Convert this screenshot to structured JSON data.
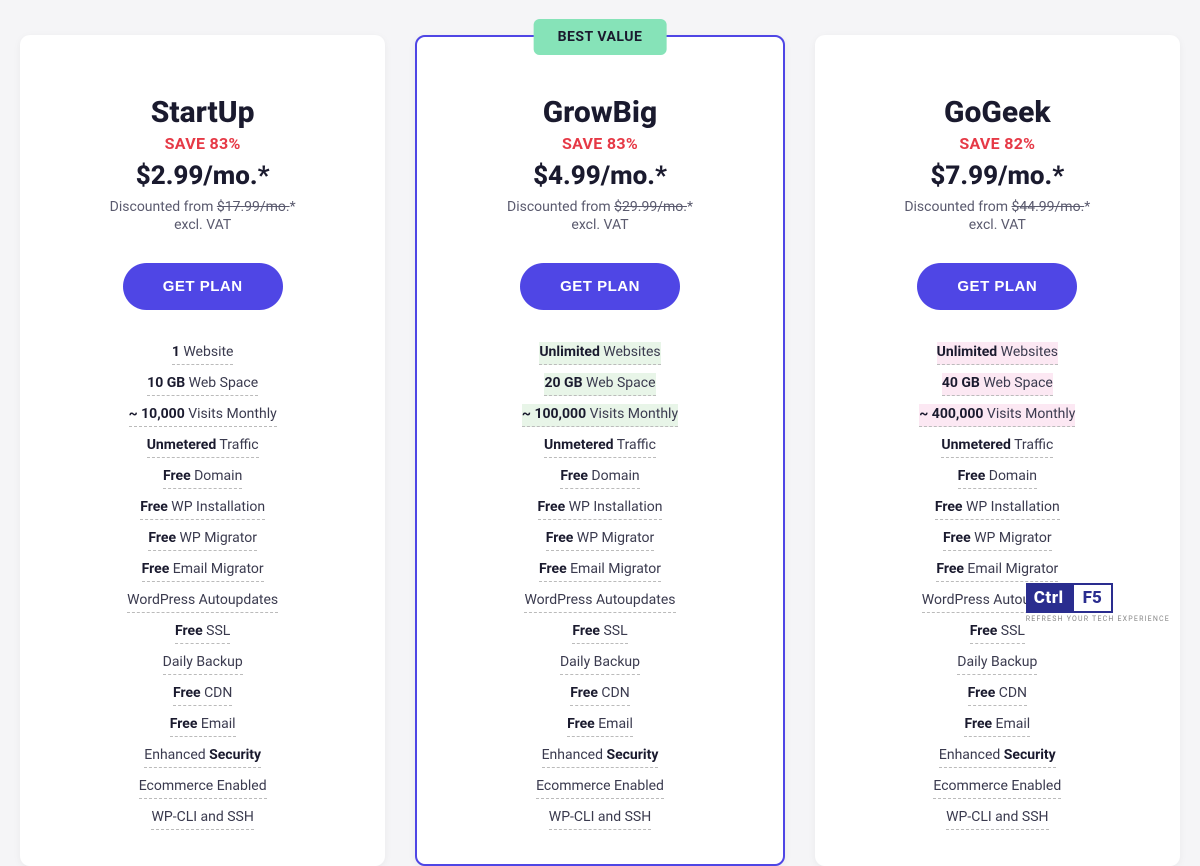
{
  "plans": [
    {
      "name": "StartUp",
      "save": "SAVE 83%",
      "price": "$2.99/mo.*",
      "discount_prefix": "Discounted from ",
      "discount_strike": "$17.99/mo.",
      "discount_suffix": "*",
      "vat": "excl. VAT",
      "cta": "GET PLAN",
      "featured": false,
      "badge": null,
      "features": [
        {
          "bold": "1",
          "rest": " Website",
          "highlight": null
        },
        {
          "bold": "10 GB",
          "rest": " Web Space",
          "highlight": null
        },
        {
          "bold": "~ 10,000",
          "rest": " Visits Monthly",
          "highlight": null
        },
        {
          "bold": "Unmetered",
          "rest": " Traffic",
          "highlight": null
        },
        {
          "bold": "Free",
          "rest": " Domain",
          "highlight": null
        },
        {
          "bold": "Free",
          "rest": " WP Installation",
          "highlight": null
        },
        {
          "bold": "Free",
          "rest": " WP Migrator",
          "highlight": null
        },
        {
          "bold": "Free",
          "rest": " Email Migrator",
          "highlight": null
        },
        {
          "bold": "",
          "rest": "WordPress Autoupdates",
          "highlight": null
        },
        {
          "bold": "Free",
          "rest": " SSL",
          "highlight": null
        },
        {
          "bold": "",
          "rest": "Daily Backup",
          "highlight": null
        },
        {
          "bold": "Free",
          "rest": " CDN",
          "highlight": null
        },
        {
          "bold": "Free",
          "rest": " Email",
          "highlight": null
        },
        {
          "prefix": "Enhanced ",
          "bold": "Security",
          "rest": "",
          "highlight": null
        },
        {
          "prefix": "Ecommerce ",
          "bold": "",
          "rest": "Enabled",
          "highlight": null
        },
        {
          "bold": "",
          "rest": "WP-CLI and SSH",
          "highlight": null
        }
      ]
    },
    {
      "name": "GrowBig",
      "save": "SAVE 83%",
      "price": "$4.99/mo.*",
      "discount_prefix": "Discounted from ",
      "discount_strike": "$29.99/mo.",
      "discount_suffix": "*",
      "vat": "excl. VAT",
      "cta": "GET PLAN",
      "featured": true,
      "badge": "BEST VALUE",
      "features": [
        {
          "bold": "Unlimited",
          "rest": " Websites",
          "highlight": "green"
        },
        {
          "bold": "20 GB",
          "rest": " Web Space",
          "highlight": "green"
        },
        {
          "bold": "~ 100,000",
          "rest": " Visits Monthly",
          "highlight": "green"
        },
        {
          "bold": "Unmetered",
          "rest": " Traffic",
          "highlight": null
        },
        {
          "bold": "Free",
          "rest": " Domain",
          "highlight": null
        },
        {
          "bold": "Free",
          "rest": " WP Installation",
          "highlight": null
        },
        {
          "bold": "Free",
          "rest": " WP Migrator",
          "highlight": null
        },
        {
          "bold": "Free",
          "rest": " Email Migrator",
          "highlight": null
        },
        {
          "bold": "",
          "rest": "WordPress Autoupdates",
          "highlight": null
        },
        {
          "bold": "Free",
          "rest": " SSL",
          "highlight": null
        },
        {
          "bold": "",
          "rest": "Daily Backup",
          "highlight": null
        },
        {
          "bold": "Free",
          "rest": " CDN",
          "highlight": null
        },
        {
          "bold": "Free",
          "rest": " Email",
          "highlight": null
        },
        {
          "prefix": "Enhanced ",
          "bold": "Security",
          "rest": "",
          "highlight": null
        },
        {
          "prefix": "Ecommerce ",
          "bold": "",
          "rest": "Enabled",
          "highlight": null
        },
        {
          "bold": "",
          "rest": "WP-CLI and SSH",
          "highlight": null
        }
      ]
    },
    {
      "name": "GoGeek",
      "save": "SAVE 82%",
      "price": "$7.99/mo.*",
      "discount_prefix": "Discounted from ",
      "discount_strike": "$44.99/mo.",
      "discount_suffix": "*",
      "vat": "excl. VAT",
      "cta": "GET PLAN",
      "featured": false,
      "badge": null,
      "features": [
        {
          "bold": "Unlimited",
          "rest": " Websites",
          "highlight": "pink"
        },
        {
          "bold": "40 GB",
          "rest": " Web Space",
          "highlight": "pink"
        },
        {
          "bold": "~ 400,000",
          "rest": " Visits Monthly",
          "highlight": "pink"
        },
        {
          "bold": "Unmetered",
          "rest": " Traffic",
          "highlight": null
        },
        {
          "bold": "Free",
          "rest": " Domain",
          "highlight": null
        },
        {
          "bold": "Free",
          "rest": " WP Installation",
          "highlight": null
        },
        {
          "bold": "Free",
          "rest": " WP Migrator",
          "highlight": null
        },
        {
          "bold": "Free",
          "rest": " Email Migrator",
          "highlight": null
        },
        {
          "bold": "",
          "rest": "WordPress Autoupdates",
          "highlight": null
        },
        {
          "bold": "Free",
          "rest": " SSL",
          "highlight": null
        },
        {
          "bold": "",
          "rest": "Daily Backup",
          "highlight": null
        },
        {
          "bold": "Free",
          "rest": " CDN",
          "highlight": null
        },
        {
          "bold": "Free",
          "rest": " Email",
          "highlight": null
        },
        {
          "prefix": "Enhanced ",
          "bold": "Security",
          "rest": "",
          "highlight": null
        },
        {
          "prefix": "Ecommerce ",
          "bold": "",
          "rest": "Enabled",
          "highlight": null
        },
        {
          "bold": "",
          "rest": "WP-CLI and SSH",
          "highlight": null
        }
      ]
    }
  ],
  "watermark": {
    "ctrl": "Ctrl",
    "f5": "F5",
    "tag": "REFRESH YOUR TECH EXPERIENCE"
  }
}
